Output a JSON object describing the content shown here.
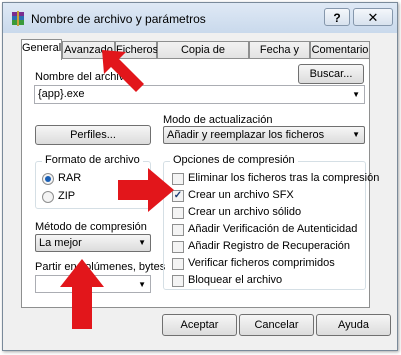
{
  "window": {
    "title": "Nombre de archivo y parámetros",
    "help_label": "?",
    "close_label": "✕",
    "icon": "winrar-icon"
  },
  "tabs": [
    {
      "label": "General",
      "active": true
    },
    {
      "label": "Avanzado",
      "active": false
    },
    {
      "label": "Ficheros",
      "active": false
    },
    {
      "label": "Copia de seguridad",
      "active": false
    },
    {
      "label": "Fecha y hora",
      "active": false
    },
    {
      "label": "Comentario",
      "active": false
    }
  ],
  "general": {
    "archive_name_label": "Nombre del archivo",
    "archive_name_value": "{app}.exe",
    "browse_label": "Buscar...",
    "profiles_label": "Perfiles...",
    "update_mode_label": "Modo de actualización",
    "update_mode_value": "Añadir y reemplazar los ficheros",
    "format_group_label": "Formato de archivo",
    "format_options": [
      {
        "label": "RAR",
        "checked": true
      },
      {
        "label": "ZIP",
        "checked": false
      }
    ],
    "compression_method_label": "Método de compresión",
    "compression_method_value": "La mejor",
    "split_label": "Partir en volúmenes, bytes",
    "split_value": "",
    "options_group_label": "Opciones de compresión",
    "options": [
      {
        "label": "Eliminar los ficheros tras la compresión",
        "checked": false
      },
      {
        "label": "Crear un archivo SFX",
        "checked": true
      },
      {
        "label": "Crear un archivo sólido",
        "checked": false
      },
      {
        "label": "Añadir Verificación de Autenticidad",
        "checked": false
      },
      {
        "label": "Añadir Registro de Recuperación",
        "checked": false
      },
      {
        "label": "Verificar ficheros comprimidos",
        "checked": false
      },
      {
        "label": "Bloquear el archivo",
        "checked": false
      }
    ]
  },
  "buttons": {
    "accept": "Aceptar",
    "cancel": "Cancelar",
    "help": "Ayuda"
  },
  "annotation_color": "#e2161b"
}
